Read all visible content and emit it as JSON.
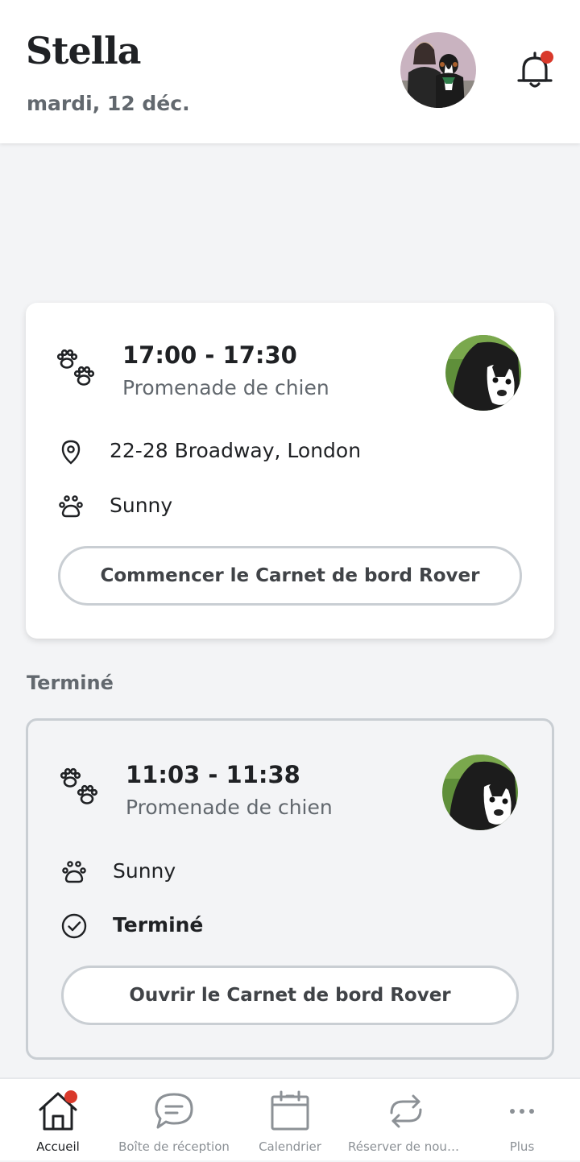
{
  "header": {
    "name": "Stella",
    "date": "mardi, 12 déc."
  },
  "upcoming": {
    "time": "17:00 - 17:30",
    "service": "Promenade de chien",
    "address": "22-28 Broadway, London",
    "pet": "Sunny",
    "button": "Commencer le Carnet de bord Rover"
  },
  "completed_section": {
    "label": "Terminé"
  },
  "completed": {
    "time": "11:03 - 11:38",
    "service": "Promenade de chien",
    "pet": "Sunny",
    "status": "Terminé",
    "button": "Ouvrir le Carnet de bord Rover"
  },
  "nav": {
    "items": [
      {
        "label": "Accueil",
        "icon": "home-icon",
        "active": true
      },
      {
        "label": "Boîte de réception",
        "icon": "chat-icon"
      },
      {
        "label": "Calendrier",
        "icon": "calendar-icon"
      },
      {
        "label": "Réserver de nouv…",
        "icon": "repeat-icon"
      },
      {
        "label": "Plus",
        "icon": "more-icon"
      }
    ]
  },
  "colors": {
    "accent_red": "#d9392b",
    "background": "#f3f4f6",
    "text": "#1f2124",
    "muted": "#62686e"
  }
}
